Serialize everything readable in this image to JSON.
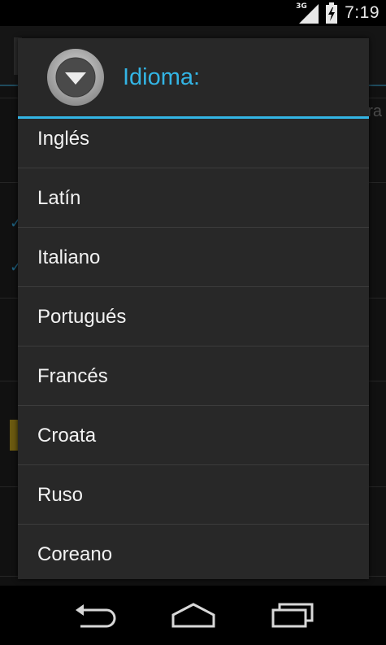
{
  "status_bar": {
    "network_type": "3G",
    "time": "7:19"
  },
  "background_app": {
    "partial_tab_text": "ra"
  },
  "dialog": {
    "title": "Idioma:",
    "icon": "dropdown-circle-icon",
    "accent_color": "#33b5e5",
    "items": [
      {
        "label": "Inglés"
      },
      {
        "label": "Latín"
      },
      {
        "label": "Italiano"
      },
      {
        "label": "Portugués"
      },
      {
        "label": "Francés"
      },
      {
        "label": "Croata"
      },
      {
        "label": "Ruso"
      },
      {
        "label": "Coreano"
      }
    ]
  },
  "nav_bar": {
    "back_icon": "back-icon",
    "home_icon": "home-icon",
    "recents_icon": "recents-icon"
  }
}
